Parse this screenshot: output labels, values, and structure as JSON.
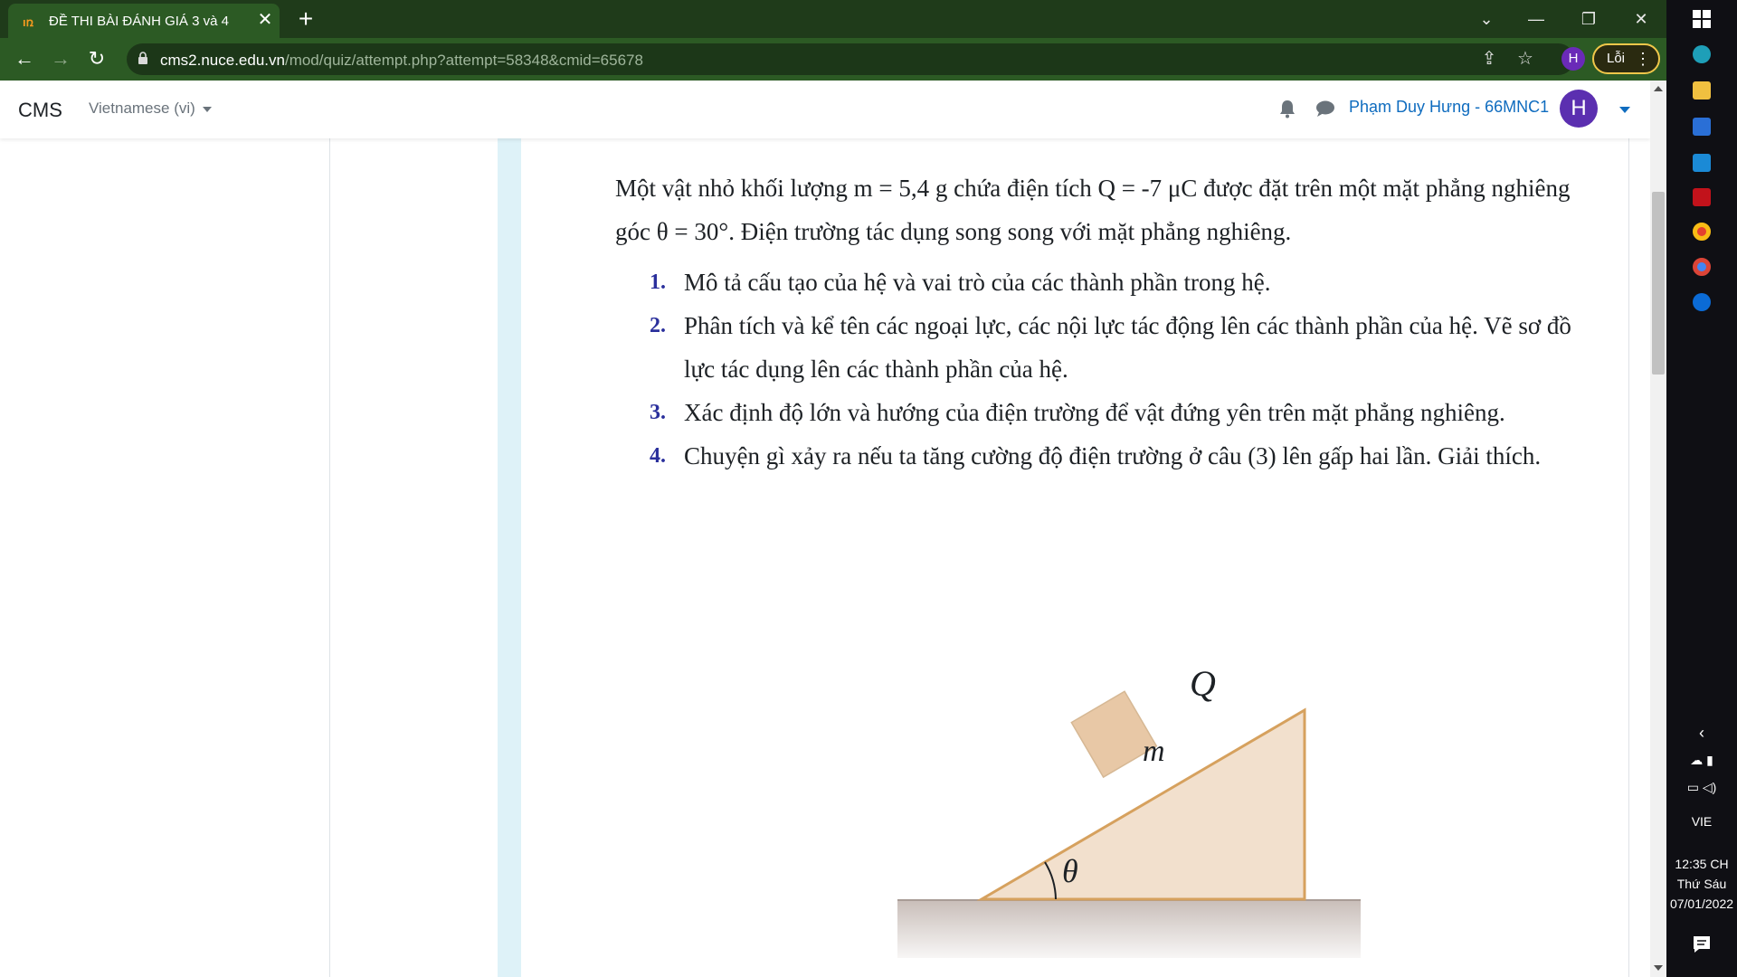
{
  "browser": {
    "tab_title": "ĐỀ THI BÀI ĐÁNH GIÁ 3 và 4",
    "tab_close": "✕",
    "new_tab": "+",
    "url_host": "cms2.nuce.edu.vn",
    "url_path": "/mod/quiz/attempt.php?attempt=58348&cmid=65678",
    "profile_initial": "H",
    "error_button_label": "Lỗi",
    "accent_color": "#2c5a24"
  },
  "navbar": {
    "brand": "CMS",
    "language": "Vietnamese (vi)",
    "user_name": "Phạm Duy Hưng - 66MNC1",
    "avatar_initial": "H"
  },
  "question": {
    "intro": "Một vật nhỏ khối lượng m = 5,4 g chứa điện tích Q = -7 μC được đặt trên một mặt phẳng nghiêng góc θ = 30°. Điện trường tác dụng song song với mặt phẳng nghiêng.",
    "items": [
      {
        "num": "1.",
        "text": "Mô tả cấu tạo của hệ và vai trò của các thành phần trong hệ."
      },
      {
        "num": "2.",
        "text": "Phân tích và kể tên các ngoại lực, các nội lực tác động lên các thành phần của hệ. Vẽ sơ đồ lực tác dụng lên các thành phần của hệ."
      },
      {
        "num": "3.",
        "text": "Xác định độ lớn và hướng của điện trường để vật đứng yên trên mặt phẳng nghiêng."
      },
      {
        "num": "4.",
        "text": "Chuyện gì xảy ra nếu ta tăng cường độ điện trường ở câu (3) lên gấp hai lần. Giải thích."
      }
    ],
    "figure": {
      "label_charge": "Q",
      "label_mass": "m",
      "label_angle": "θ"
    }
  },
  "taskbar": {
    "language": "VIE",
    "time": "12:35 CH",
    "day": "Thứ Sáu",
    "date": "07/01/2022"
  }
}
